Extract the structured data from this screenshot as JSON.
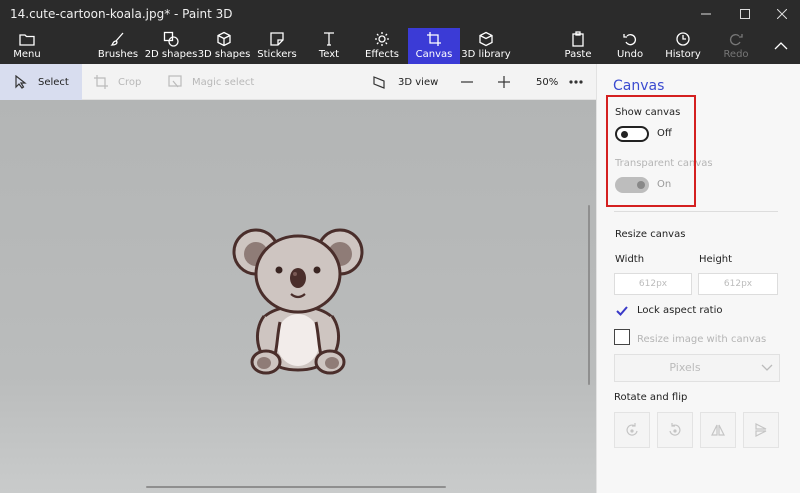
{
  "window": {
    "title": "14.cute-cartoon-koala.jpg* - Paint 3D"
  },
  "ribbon": {
    "menu": "Menu",
    "brushes": "Brushes",
    "shapes2d": "2D shapes",
    "shapes3d": "3D shapes",
    "stickers": "Stickers",
    "text": "Text",
    "effects": "Effects",
    "canvas": "Canvas",
    "library3d": "3D library",
    "paste": "Paste",
    "undo": "Undo",
    "history": "History",
    "redo": "Redo",
    "active_color": "#3b3bd6"
  },
  "toolbar": {
    "select": "Select",
    "crop": "Crop",
    "magic_select": "Magic select",
    "view3d": "3D view",
    "zoom": "50%"
  },
  "panel": {
    "title": "Canvas",
    "show_canvas": {
      "label": "Show canvas",
      "state": "Off"
    },
    "transparent_canvas": {
      "label": "Transparent canvas",
      "state": "On"
    },
    "resize_canvas": "Resize canvas",
    "width_label": "Width",
    "height_label": "Height",
    "width_value": "612px",
    "height_value": "612px",
    "lock_aspect": "Lock aspect ratio",
    "resize_image": "Resize image with canvas",
    "units": "Pixels",
    "rotate_flip": "Rotate and flip"
  }
}
